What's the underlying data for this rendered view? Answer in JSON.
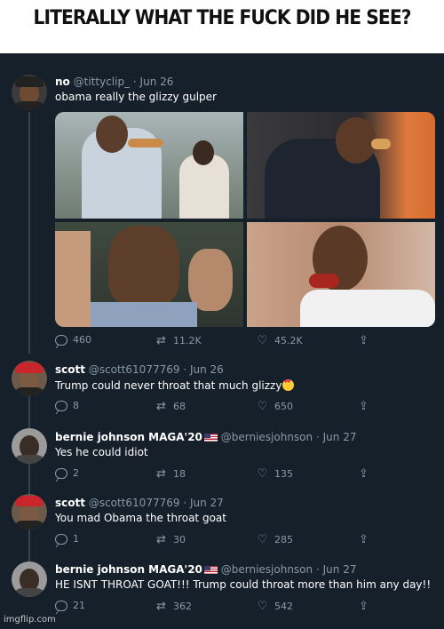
{
  "caption": "LITERALLY WHAT THE FUCK DID HE SEE?",
  "colors": {
    "background": "#15202b",
    "text": "#ffffff",
    "secondary": "#8899a6"
  },
  "tweets": [
    {
      "name": "no",
      "handle": "@tittyclip_",
      "date": "Jun 26",
      "text": "obama really the glizzy gulper",
      "reply_count": "460",
      "retweet_count": "11.2K",
      "like_count": "45.2K",
      "avatar": "man-avatar-dark-hat"
    },
    {
      "name": "scott",
      "handle": "@scott61077769",
      "date": "Jun 26",
      "text": "Trump could never throat that much glizzy",
      "emoji": "heart-eyes-emoji",
      "reply_count": "8",
      "retweet_count": "68",
      "like_count": "650",
      "avatar": "man-avatar-red-hat"
    },
    {
      "name": "bernie johnson MAGA'20",
      "handle": "@berniesjohnson",
      "date": "Jun 27",
      "text": "Yes he could idiot",
      "reply_count": "2",
      "retweet_count": "18",
      "like_count": "135",
      "avatar": "man-avatar-gray"
    },
    {
      "name": "scott",
      "handle": "@scott61077769",
      "date": "Jun 27",
      "text": "You mad Obama the throat goat",
      "reply_count": "1",
      "retweet_count": "30",
      "like_count": "285",
      "avatar": "man-avatar-red-hat"
    },
    {
      "name": "bernie johnson MAGA'20",
      "handle": "@berniesjohnson",
      "date": "Jun 27",
      "text": "HE ISNT THROAT GOAT!!! Trump could throat more than him any day!!",
      "reply_count": "21",
      "retweet_count": "362",
      "like_count": "542",
      "avatar": "man-avatar-gray"
    }
  ],
  "icons": {
    "reply": "reply-icon",
    "retweet": "retweet-icon",
    "like": "heart-icon",
    "share": "share-icon"
  },
  "watermark": "imgflip.com"
}
